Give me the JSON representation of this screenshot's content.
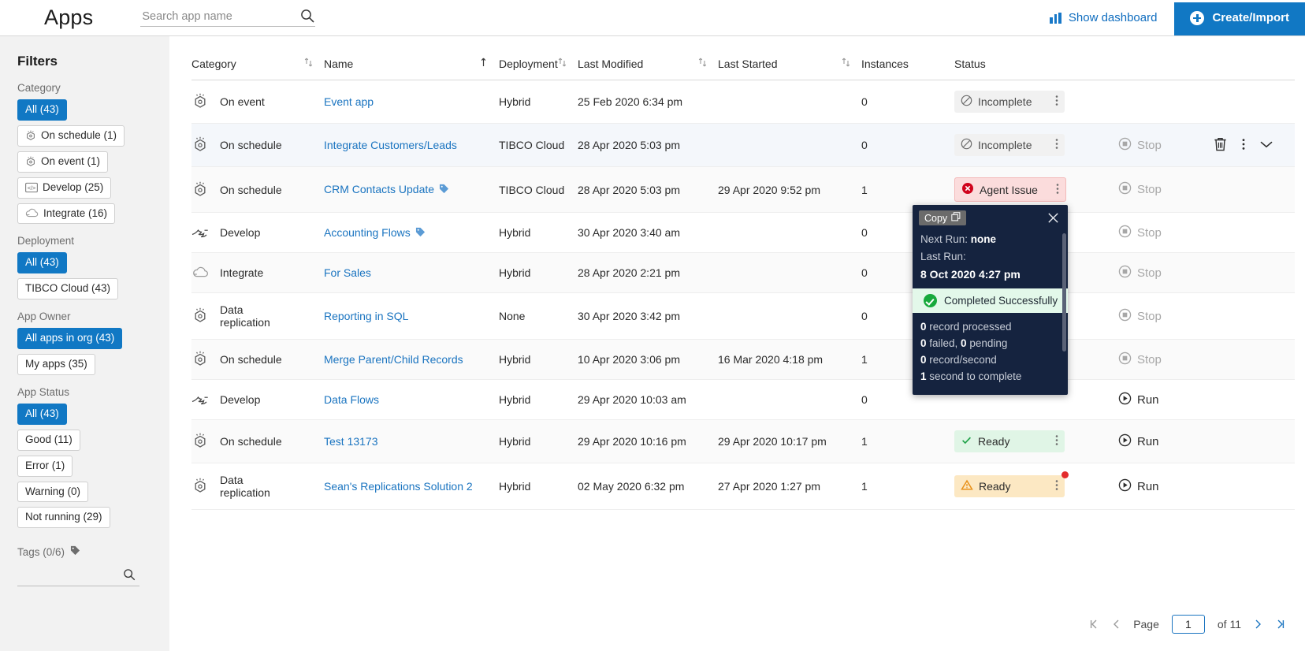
{
  "header": {
    "title": "Apps",
    "search_placeholder": "Search app name",
    "search_value": "",
    "show_dashboard_label": "Show dashboard",
    "create_import_label": "Create/Import",
    "accent_color": "#1178c4"
  },
  "sidebar": {
    "title": "Filters",
    "groups": [
      {
        "label": "Category",
        "chips": [
          {
            "label": "All (43)",
            "active": true,
            "icon": null
          },
          {
            "label": "On schedule (1)",
            "active": false,
            "icon": "schedule-icon"
          },
          {
            "label": "On event (1)",
            "active": false,
            "icon": "event-icon"
          },
          {
            "label": "Develop (25)",
            "active": false,
            "icon": "code-icon"
          },
          {
            "label": "Integrate (16)",
            "active": false,
            "icon": "cloud-icon"
          }
        ]
      },
      {
        "label": "Deployment",
        "chips": [
          {
            "label": "All (43)",
            "active": true,
            "icon": null
          },
          {
            "label": "TIBCO Cloud (43)",
            "active": false,
            "icon": null
          }
        ]
      },
      {
        "label": "App Owner",
        "chips": [
          {
            "label": "All apps in org (43)",
            "active": true,
            "icon": null
          },
          {
            "label": "My apps (35)",
            "active": false,
            "icon": null
          }
        ]
      },
      {
        "label": "App Status",
        "chips": [
          {
            "label": "All (43)",
            "active": true,
            "icon": null
          },
          {
            "label": "Good (11)",
            "active": false,
            "icon": null
          },
          {
            "label": "Error (1)",
            "active": false,
            "icon": null
          },
          {
            "label": "Warning (0)",
            "active": false,
            "icon": null
          },
          {
            "label": "Not running (29)",
            "active": false,
            "icon": null
          }
        ]
      }
    ],
    "tags_label": "Tags (0/6)",
    "tag_search_value": ""
  },
  "table": {
    "columns": [
      {
        "label": "Category",
        "sort": "both"
      },
      {
        "label": "Name",
        "sort": "asc"
      },
      {
        "label": "Deployment",
        "sort": "both"
      },
      {
        "label": "Last Modified",
        "sort": "both"
      },
      {
        "label": "Last Started",
        "sort": "both"
      },
      {
        "label": "Instances",
        "sort": "none"
      },
      {
        "label": "Status",
        "sort": "none"
      }
    ],
    "rows": [
      {
        "category": "On event",
        "category_icon": "event-icon",
        "name": "Event app",
        "has_tag": false,
        "deployment": "Hybrid",
        "last_modified": "25 Feb 2020 6:34 pm",
        "last_started": "",
        "instances": "0",
        "status": "Incomplete",
        "status_kind": "incomplete",
        "action": "",
        "action_kind": "none",
        "show_delete": false,
        "red_dot": false
      },
      {
        "category": "On schedule",
        "category_icon": "schedule-icon",
        "name": "Integrate Customers/Leads",
        "has_tag": false,
        "deployment": "TIBCO Cloud",
        "last_modified": "28 Apr 2020 5:03 pm",
        "last_started": "",
        "instances": "0",
        "status": "Incomplete",
        "status_kind": "incomplete",
        "action": "Stop",
        "action_kind": "stop",
        "show_delete": true,
        "red_dot": false
      },
      {
        "category": "On schedule",
        "category_icon": "schedule-icon",
        "name": "CRM Contacts Update",
        "has_tag": true,
        "deployment": "TIBCO Cloud",
        "last_modified": "28 Apr 2020 5:03 pm",
        "last_started": "29 Apr 2020 9:52 pm",
        "instances": "1",
        "status": "Agent Issue",
        "status_kind": "error",
        "action": "Stop",
        "action_kind": "stop",
        "show_delete": false,
        "red_dot": false
      },
      {
        "category": "Develop",
        "category_icon": "develop-icon",
        "name": "Accounting Flows",
        "has_tag": true,
        "deployment": "Hybrid",
        "last_modified": "30 Apr 2020 3:40 am",
        "last_started": "",
        "instances": "0",
        "status": "",
        "status_kind": "hidden",
        "action": "Stop",
        "action_kind": "stop",
        "show_delete": false,
        "red_dot": false
      },
      {
        "category": "Integrate",
        "category_icon": "cloud-icon",
        "name": "For Sales",
        "has_tag": false,
        "deployment": "Hybrid",
        "last_modified": "28 Apr 2020 2:21 pm",
        "last_started": "",
        "instances": "0",
        "status": "",
        "status_kind": "hidden",
        "action": "Stop",
        "action_kind": "stop",
        "show_delete": false,
        "red_dot": false
      },
      {
        "category": "Data replication",
        "category_icon": "schedule-icon",
        "name": "Reporting in SQL",
        "has_tag": false,
        "deployment": "None",
        "last_modified": "30 Apr 2020 3:42 pm",
        "last_started": "",
        "instances": "0",
        "status": "",
        "status_kind": "hidden",
        "action": "Stop",
        "action_kind": "stop",
        "show_delete": false,
        "red_dot": false
      },
      {
        "category": "On schedule",
        "category_icon": "schedule-icon",
        "name": "Merge Parent/Child Records",
        "has_tag": false,
        "deployment": "Hybrid",
        "last_modified": "10 Apr 2020 3:06 pm",
        "last_started": "16 Mar 2020 4:18 pm",
        "instances": "1",
        "status": "",
        "status_kind": "hidden",
        "action": "Stop",
        "action_kind": "stop",
        "show_delete": false,
        "red_dot": false
      },
      {
        "category": "Develop",
        "category_icon": "develop-icon",
        "name": "Data Flows",
        "has_tag": false,
        "deployment": "Hybrid",
        "last_modified": "29 Apr 2020 10:03 am",
        "last_started": "",
        "instances": "0",
        "status": "",
        "status_kind": "hidden",
        "action": "Run",
        "action_kind": "run",
        "show_delete": false,
        "red_dot": false
      },
      {
        "category": "On schedule",
        "category_icon": "schedule-icon",
        "name": "Test 13173",
        "has_tag": false,
        "deployment": "Hybrid",
        "last_modified": "29 Apr 2020 10:16 pm",
        "last_started": "29 Apr 2020 10:17 pm",
        "instances": "1",
        "status": "Ready",
        "status_kind": "ready-good",
        "action": "Run",
        "action_kind": "run",
        "show_delete": false,
        "red_dot": false
      },
      {
        "category": "Data replication",
        "category_icon": "schedule-icon",
        "name": "Sean's Replications Solution 2",
        "has_tag": false,
        "deployment": "Hybrid",
        "last_modified": "02 May 2020 6:32 pm",
        "last_started": "27 Apr 2020 1:27 pm",
        "instances": "1",
        "status": "Ready",
        "status_kind": "ready-warn",
        "action": "Run",
        "action_kind": "run",
        "show_delete": false,
        "red_dot": true
      }
    ]
  },
  "popover": {
    "copy_label": "Copy",
    "next_run_label": "Next Run:",
    "next_run_value": "none",
    "last_run_label": "Last Run:",
    "last_run_value": "8 Oct 2020 4:27 pm",
    "result_label": "Completed Successfully",
    "stats": [
      {
        "num": "0",
        "text": " record processed"
      },
      {
        "num": "0",
        "text": " failed, ",
        "num2": "0",
        "text2": " pending"
      },
      {
        "num": "0",
        "text": " record/second"
      },
      {
        "num": "1",
        "text": " second to complete"
      }
    ]
  },
  "pagination": {
    "page_label": "Page",
    "page_value": "1",
    "of_label": "of 11"
  }
}
